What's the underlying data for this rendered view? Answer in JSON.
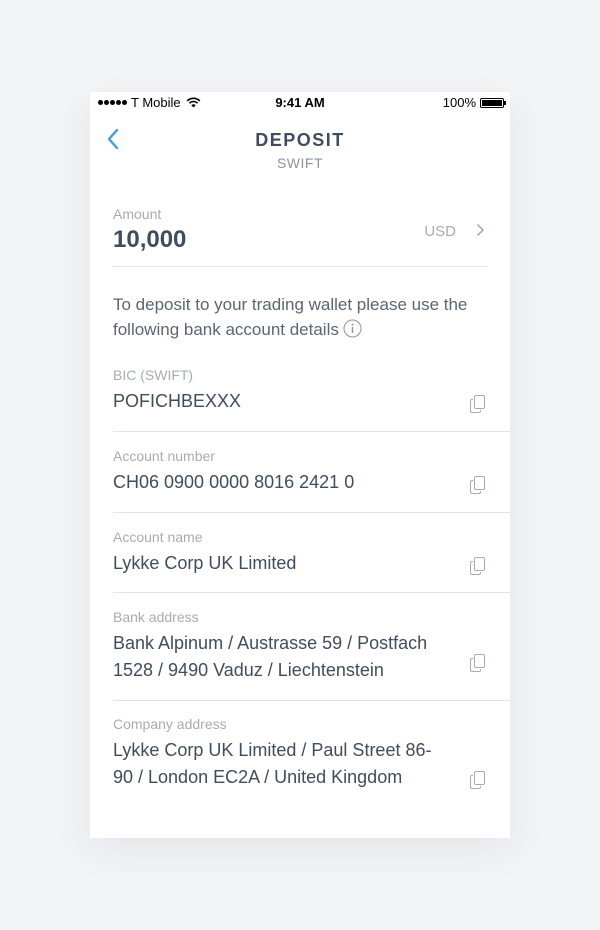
{
  "status_bar": {
    "carrier": "T Mobile",
    "time": "9:41 AM",
    "battery": "100%"
  },
  "header": {
    "title": "DEPOSIT",
    "subtitle": "SWIFT",
    "back_icon": "chevron-left-icon"
  },
  "amount": {
    "label": "Amount",
    "value": "10,000",
    "currency": "USD",
    "chevron_icon": "chevron-right-icon"
  },
  "instructions": "To deposit to your trading wallet please use the following bank account details",
  "details": [
    {
      "label": "BIC (SWIFT)",
      "value": "POFICHBEXXX",
      "icon": "copy-icon"
    },
    {
      "label": "Account number",
      "value": "CH06 0900 0000 8016 2421 0",
      "icon": "copy-icon"
    },
    {
      "label": "Account name",
      "value": "Lykke Corp UK Limited",
      "icon": "copy-icon"
    },
    {
      "label": "Bank address",
      "value": "Bank Alpinum / Austrasse 59 / Postfach 1528 / 9490 Vaduz / Liechtenstein",
      "icon": "copy-icon"
    },
    {
      "label": "Company address",
      "value": "Lykke Corp UK Limited / Paul Street 86-90 / London EC2A / United Kingdom",
      "icon": "copy-icon"
    }
  ],
  "colors": {
    "accent": "#3aa0dc",
    "text_dark": "#3f4d60",
    "text_muted": "#a6acb5",
    "divider": "#e1e4e8",
    "background": "#f3f4f6"
  }
}
